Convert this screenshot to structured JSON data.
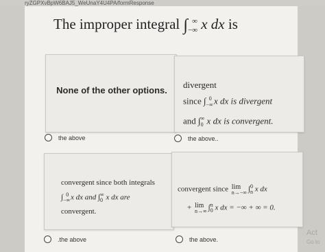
{
  "browser": {
    "url_fragment": "ryZGPXvBpW6BAJ5_WeUnaY4U4PA/formResponse"
  },
  "question": {
    "prefix": "The improper integral ",
    "integral_lower": "−∞",
    "integral_upper": "∞",
    "integrand": "x dx",
    "suffix": " is"
  },
  "options": [
    {
      "text": "None of the other options.",
      "radio_label": "the above"
    },
    {
      "line1": "divergent",
      "line2_pre": "since ",
      "line2_lower": "−∞",
      "line2_upper": "0",
      "line2_post": "x dx is divergent",
      "line3_pre": "and ",
      "line3_lower": "0",
      "line3_upper": "∞",
      "line3_post": "x dx is convergent.",
      "radio_label": "the above.."
    },
    {
      "line1": "convergent since both integrals",
      "line2_a_lower": "−∞",
      "line2_a_upper": "0",
      "line2_a_post": "x dx and ",
      "line2_b_lower": "0",
      "line2_b_upper": "∞",
      "line2_b_post": "x dx are",
      "line3": "convergent.",
      "radio_label": ".the above"
    },
    {
      "line1_pre": "convergent since ",
      "lim1_word": "lim",
      "lim1_sub": "n→−∞",
      "line1_int_lower": "n",
      "line1_int_upper": "0",
      "line1_post": "x dx",
      "line2_plus": "+ ",
      "lim2_word": "lim",
      "lim2_sub": "n→∞",
      "line2_int_lower": "0",
      "line2_int_upper": "n",
      "line2_post": "x dx = −∞ + ∞ = 0.",
      "radio_label": "the above."
    }
  ],
  "watermark": {
    "line1": "Act",
    "line2": "Go to"
  }
}
